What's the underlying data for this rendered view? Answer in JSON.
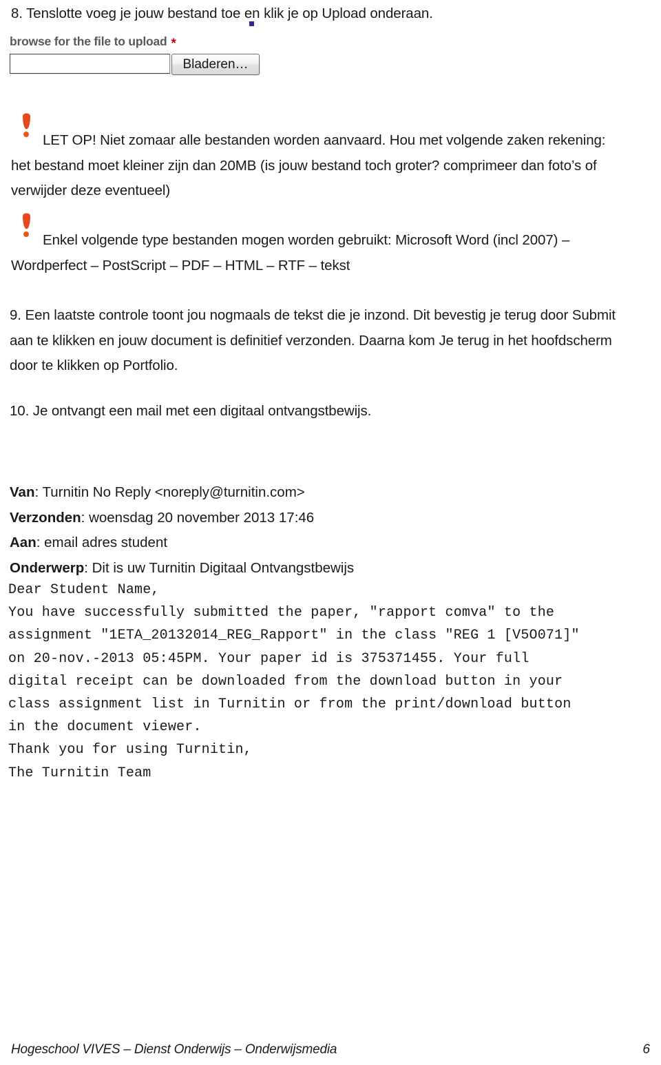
{
  "document": {
    "steps": {
      "step8": "8. Tenslotte voeg je jouw bestand toe en klik je op Upload onderaan.",
      "step9": {
        "line1": "9. Een laatste controle toont jou nogmaals de tekst die je inzond. Dit bevestig je terug door Submit",
        "line2": "aan te klikken en jouw document is definitief verzonden. Daarna kom Je terug in het hoofdscherm",
        "line3": "door te klikken op Portfolio."
      },
      "step10": "10. Je ontvangt een mail met een digitaal ontvangstbewijs."
    },
    "browse_widget": {
      "label": "browse for the file to upload",
      "required_marker": "*",
      "input_value": "",
      "button_label": "Bladeren…"
    },
    "warnings": [
      {
        "icon": "exclamation-icon",
        "line1": "LET OP! Niet zomaar alle bestanden worden aanvaard. Hou met volgende zaken rekening:",
        "line2": "het bestand moet kleiner zijn dan 20MB (is jouw bestand toch groter? comprimeer dan foto’s of",
        "line3": "verwijder deze eventueel)"
      },
      {
        "icon": "exclamation-icon",
        "line1": "Enkel volgende type bestanden mogen worden gebruikt: Microsoft Word (incl 2007) –",
        "line2": "Wordperfect – PostScript – PDF – HTML – RTF – tekst"
      }
    ],
    "email": {
      "headers": [
        {
          "label": "Van",
          "value": "Turnitin No Reply <noreply@turnitin.com>"
        },
        {
          "label": "Verzonden",
          "value": "woensdag 20 november 2013 17:46"
        },
        {
          "label": "Aan",
          "value": "email adres student"
        },
        {
          "label": "Onderwerp",
          "value": "Dit is uw Turnitin Digitaal Ontvangstbewijs"
        }
      ],
      "body_lines": [
        "Dear Student Name,",
        "You have successfully submitted the paper, \"rapport comva\" to the",
        "assignment \"1ETA_20132014_REG_Rapport\" in the class \"REG 1 [V5O071]\"",
        "on 20-nov.-2013 05:45PM. Your paper id is 375371455. Your full",
        "digital receipt can be downloaded from the download button in your",
        "class assignment list in Turnitin or from the print/download button",
        "in the document viewer.",
        "Thank you for using Turnitin,",
        "The Turnitin Team"
      ]
    },
    "footer": {
      "text": "Hogeschool VIVES – Dienst Onderwijs – Onderwijsmedia",
      "page_number": "6"
    },
    "colors": {
      "warning_icon": "#e8481e",
      "required_star": "#cc0000",
      "label_gray": "#595959",
      "artifact_blue": "#2b2b8f"
    }
  }
}
